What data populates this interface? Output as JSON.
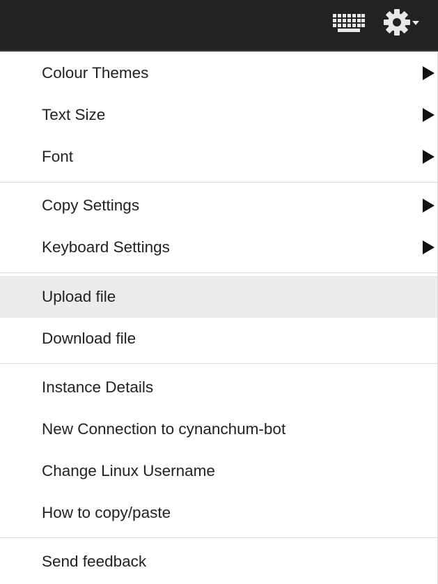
{
  "toolbar": {
    "keyboard_icon": "keyboard-icon",
    "settings_icon": "gear-icon",
    "dropdown_icon": "caret-down-icon",
    "background_color": "#222222",
    "icon_color": "#e8e8e8"
  },
  "menu": {
    "group1": {
      "colour_themes": "Colour Themes",
      "text_size": "Text Size",
      "font": "Font"
    },
    "group2": {
      "copy_settings": "Copy Settings",
      "keyboard_settings": "Keyboard Settings"
    },
    "group3": {
      "upload_file": "Upload file",
      "download_file": "Download file"
    },
    "group4": {
      "instance_details": "Instance Details",
      "new_connection": "New Connection to cynanchum-bot",
      "change_username": "Change Linux Username",
      "how_to_copy_paste": "How to copy/paste"
    },
    "group5": {
      "send_feedback": "Send feedback"
    },
    "highlighted_item": "Upload file",
    "highlight_color": "#ececec",
    "submenu_arrow_icon": "triangle-right-icon"
  }
}
